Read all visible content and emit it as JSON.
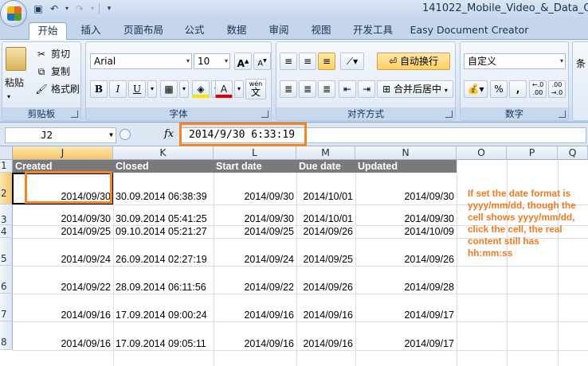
{
  "window": {
    "title": "141022_Mobile_Video_&_Data_Qu"
  },
  "tabs": [
    "开始",
    "插入",
    "页面布局",
    "公式",
    "数据",
    "审阅",
    "视图",
    "开发工具",
    "Easy Document Creator"
  ],
  "ribbon": {
    "clipboard": {
      "paste": "粘贴",
      "cut": "剪切",
      "copy": "复制",
      "format_painter": "格式刷",
      "label": "剪贴板"
    },
    "font": {
      "name": "Arial",
      "size": "10",
      "grow": "A",
      "shrink": "A",
      "bold": "B",
      "italic": "I",
      "underline": "U",
      "font_color": "A",
      "phonetic": "wén",
      "phonetic2": "文",
      "label": "字体"
    },
    "alignment": {
      "wrap_text": "自动换行",
      "merge_center": "合并后居中",
      "label": "对齐方式"
    },
    "number": {
      "format": "自定义",
      "percent": "%",
      "comma": ",",
      "inc_decimal": ".0\n.00",
      "dec_decimal": ".00\n.0",
      "label": "数字"
    }
  },
  "formula_bar": {
    "name_box": "J2",
    "fx": "fx",
    "value": "2014/9/30  6:33:19"
  },
  "columns": [
    "J",
    "K",
    "L",
    "M",
    "N",
    "O",
    "P",
    "Q"
  ],
  "row_numbers": [
    "1",
    "2",
    "3",
    "4",
    "5",
    "6",
    "7",
    "8"
  ],
  "headers": [
    "Created",
    "Closed",
    "Start date",
    "Due date",
    "Updated"
  ],
  "rows": [
    [
      "2014/09/30",
      "30.09.2014 06:38:39",
      "2014/09/30",
      "2014/10/01",
      "2014/09/30"
    ],
    [
      "2014/09/30",
      "30.09.2014 05:41:25",
      "2014/09/30",
      "2014/10/01",
      "2014/09/30"
    ],
    [
      "2014/09/25",
      "09.10.2014 05:21:27",
      "2014/09/25",
      "2014/09/26",
      "2014/10/09"
    ],
    [
      "2014/09/24",
      "26.09.2014 02:27:19",
      "2014/09/24",
      "2014/09/25",
      "2014/09/26"
    ],
    [
      "2014/09/22",
      "28.09.2014 06:11:56",
      "2014/09/22",
      "2014/09/26",
      "2014/09/28"
    ],
    [
      "2014/09/16",
      "17.09.2014 09:00:24",
      "2014/09/16",
      "2014/09/16",
      "2014/09/17"
    ],
    [
      "2014/09/16",
      "17.09.2014 09:05:11",
      "2014/09/16",
      "2014/09/16",
      "2014/09/17"
    ]
  ],
  "annotation": "If set the date format is yyyy/mm/dd, though the cell shows yyyy/mm/dd, click the cell, the real content still has hh:mm:ss",
  "colors": {
    "highlight": "#f58523",
    "header_fill": "#7a7a7a",
    "note_text": "#ee7b1f"
  }
}
